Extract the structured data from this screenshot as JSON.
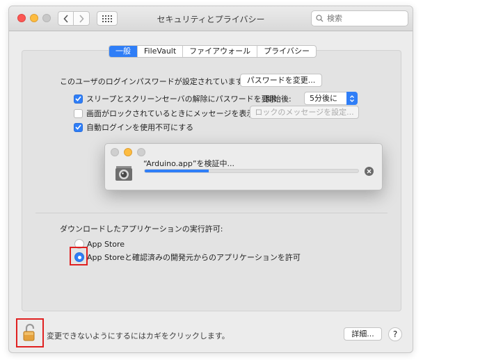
{
  "window": {
    "title": "セキュリティとプライバシー",
    "search_placeholder": "検索"
  },
  "tabs": [
    {
      "label": "一般",
      "active": true
    },
    {
      "label": "FileVault",
      "active": false
    },
    {
      "label": "ファイアウォール",
      "active": false
    },
    {
      "label": "プライバシー",
      "active": false
    }
  ],
  "general": {
    "password_label": "このユーザのログインパスワードが設定されています",
    "change_password_button": "パスワードを変更...",
    "require_password": {
      "label": "スリープとスクリーンセーバの解除にパスワードを要求",
      "checked": true
    },
    "start_after_label": "開始後:",
    "start_after_value": "5分後に",
    "show_message": {
      "label": "画面がロックされているときにメッセージを表示",
      "checked": false
    },
    "set_lock_message_button": "ロックのメッセージを設定...",
    "disable_auto_login": {
      "label": "自動ログインを使用不可にする",
      "checked": true
    }
  },
  "downloads": {
    "label": "ダウンロードしたアプリケーションの実行許可:",
    "options": [
      {
        "label": "App Store",
        "selected": false
      },
      {
        "label": "App Storeと確認済みの開発元からのアプリケーションを許可",
        "selected": true
      }
    ]
  },
  "dialog": {
    "message": "“Arduino.app”を検証中...",
    "progress": 0.3
  },
  "footer": {
    "lock_text": "変更できないようにするにはカギをクリックします。",
    "advanced_button": "詳細...",
    "help_label": "?"
  },
  "colors": {
    "accent": "#2f7ef7",
    "highlight": "#e02020"
  }
}
